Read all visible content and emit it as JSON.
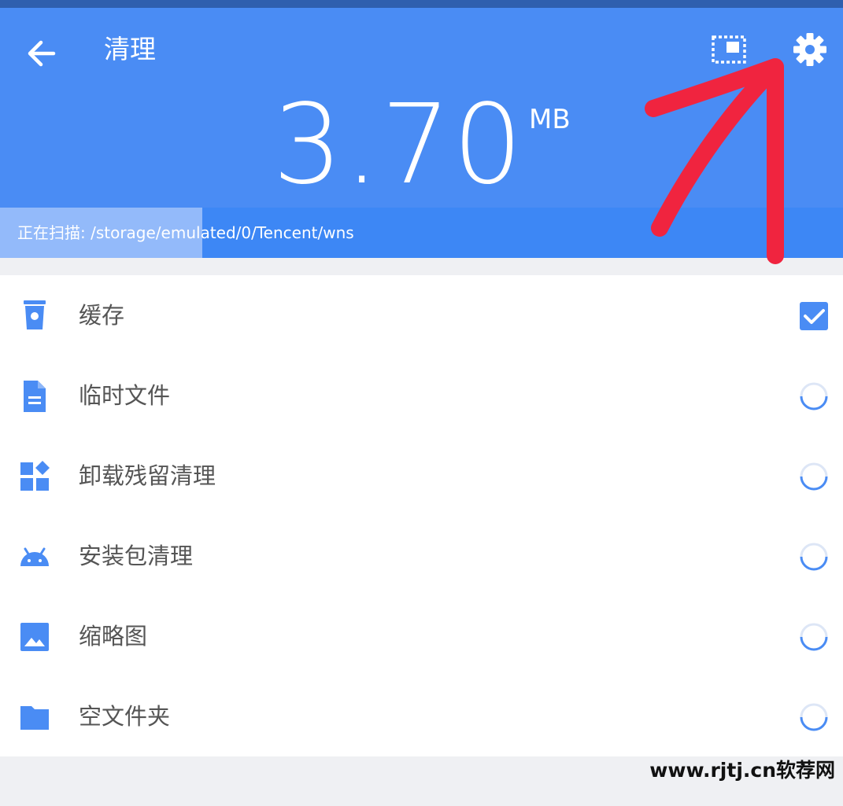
{
  "header": {
    "title": "清理",
    "size_value": "3.70",
    "size_unit": "MB",
    "back_icon": "arrow-left-icon",
    "select_icon": "select-all-icon",
    "settings_icon": "gear-icon",
    "bg_color": "#4a8cf4"
  },
  "scan": {
    "text": "正在扫描: /storage/emulated/0/Tencent/wns",
    "progress": 0.24
  },
  "items": [
    {
      "label": "缓存",
      "icon": "trash-icon",
      "state": "checked"
    },
    {
      "label": "临时文件",
      "icon": "file-icon",
      "state": "loading"
    },
    {
      "label": "卸载残留清理",
      "icon": "apps-icon",
      "state": "loading"
    },
    {
      "label": "安装包清理",
      "icon": "android-icon",
      "state": "loading"
    },
    {
      "label": "缩略图",
      "icon": "image-icon",
      "state": "loading"
    },
    {
      "label": "空文件夹",
      "icon": "folder-icon",
      "state": "loading"
    }
  ],
  "colors": {
    "accent": "#4a8cf4",
    "annotation": "#f0243f"
  },
  "watermark": "www.rjtj.cn软荐网"
}
